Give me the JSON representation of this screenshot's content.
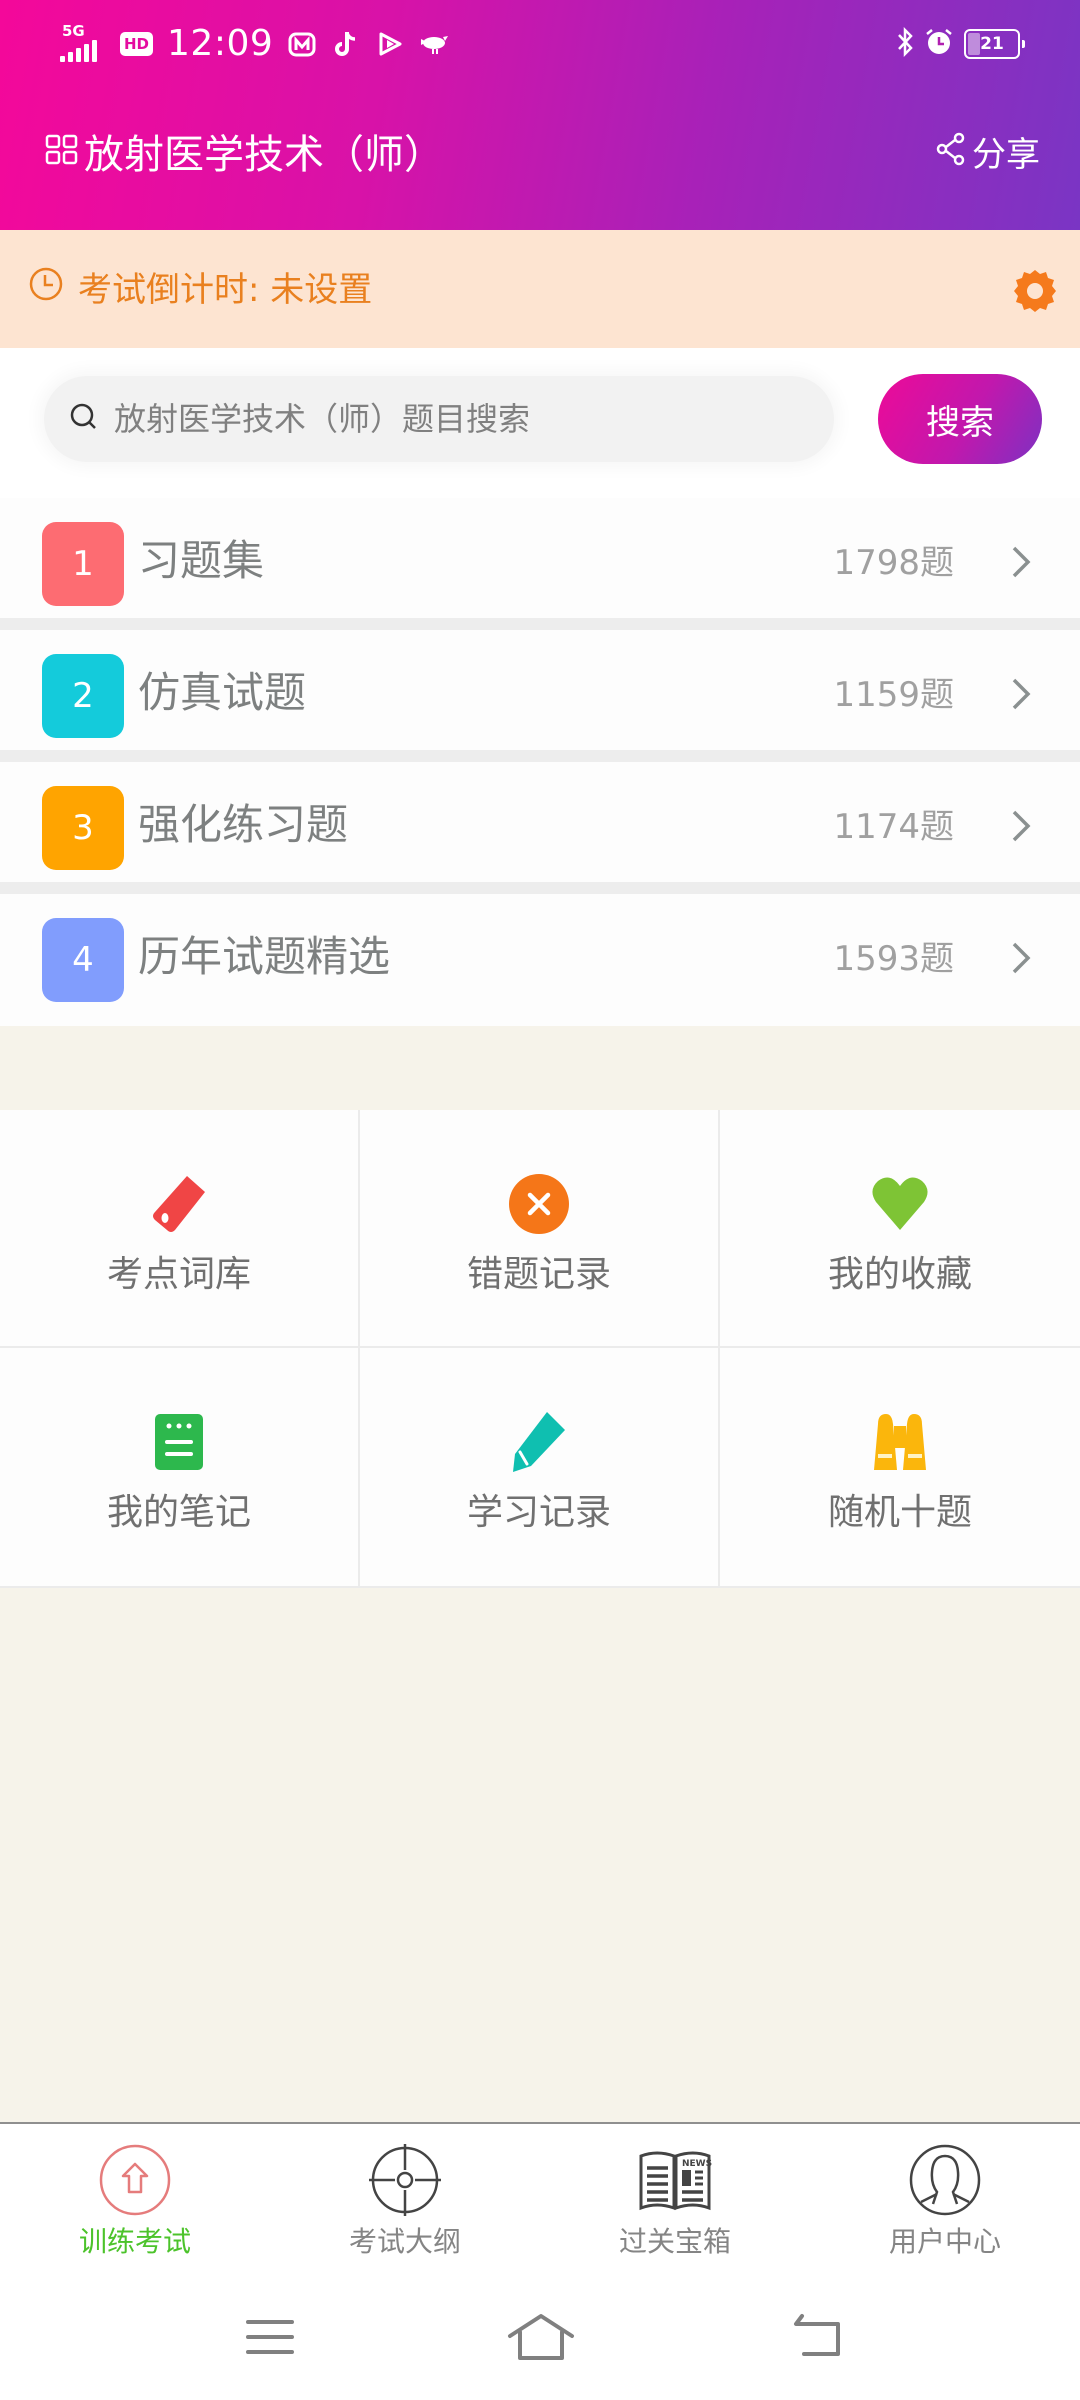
{
  "status_bar": {
    "network": "5G",
    "hd_badge": "HD",
    "time": "12:09",
    "battery_level": "21",
    "icons": [
      "signal-icon",
      "hd-icon",
      "mango-tv-icon",
      "tiktok-icon",
      "video-play-icon",
      "bird-icon",
      "bluetooth-icon",
      "alarm-icon",
      "battery-icon"
    ]
  },
  "header": {
    "title": "放射医学技术（师）",
    "title_icon": "grid-icon",
    "share_label": "分享",
    "share_icon": "share-icon",
    "gradient": [
      "#f4089a",
      "#7a35c4"
    ]
  },
  "countdown": {
    "label": "考试倒计时: 未设置",
    "icon": "clock-icon",
    "settings_icon": "gear-icon",
    "text_color": "#e9801f",
    "background": "#fde4d1"
  },
  "search": {
    "placeholder": "放射医学技术（师）题目搜索",
    "value": "",
    "button_label": "搜索"
  },
  "question_sets": [
    {
      "index": "1",
      "title": "习题集",
      "count": "1798题",
      "color": "#fd6c72"
    },
    {
      "index": "2",
      "title": "仿真试题",
      "count": "1159题",
      "color": "#14cbdb"
    },
    {
      "index": "3",
      "title": "强化练习题",
      "count": "1174题",
      "color": "#ffa400"
    },
    {
      "index": "4",
      "title": "历年试题精选",
      "count": "1593题",
      "color": "#819dfd"
    }
  ],
  "tools": [
    {
      "label": "考点词库",
      "icon": "tag-icon",
      "color": "#f04545"
    },
    {
      "label": "错题记录",
      "icon": "wrong-x-icon",
      "color": "#f57618"
    },
    {
      "label": "我的收藏",
      "icon": "heart-icon",
      "color": "#7ec435"
    },
    {
      "label": "我的笔记",
      "icon": "notebook-icon",
      "color": "#2db84d"
    },
    {
      "label": "学习记录",
      "icon": "pencil-icon",
      "color": "#0fbfb0"
    },
    {
      "label": "随机十题",
      "icon": "binoculars-icon",
      "color": "#fbb60c"
    }
  ],
  "bottom_nav": {
    "active_index": 0,
    "active_color": "#4cc32b",
    "items": [
      {
        "label": "训练考试",
        "icon": "home-circle-icon"
      },
      {
        "label": "考试大纲",
        "icon": "target-icon"
      },
      {
        "label": "过关宝箱",
        "icon": "news-book-icon"
      },
      {
        "label": "用户中心",
        "icon": "user-icon"
      }
    ]
  },
  "system_nav": [
    "menu-icon",
    "home-icon",
    "back-icon"
  ]
}
